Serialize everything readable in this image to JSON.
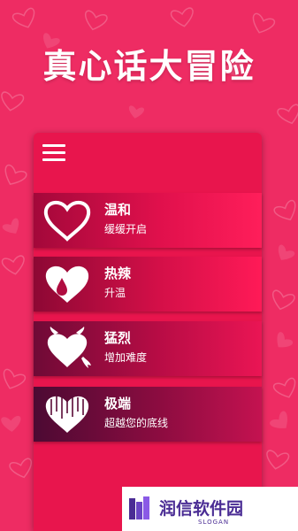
{
  "app": {
    "title": "真心话大冒险"
  },
  "menu": {
    "icon": "hamburger-menu-icon"
  },
  "modes": [
    {
      "label": "温和",
      "desc": "缓缓开启",
      "icon": "heart-outline-icon"
    },
    {
      "label": "热辣",
      "desc": "升温",
      "icon": "heart-drop-icon"
    },
    {
      "label": "猛烈",
      "desc": "增加难度",
      "icon": "devil-heart-icon"
    },
    {
      "label": "极端",
      "desc": "超越您的底线",
      "icon": "broken-heart-icon"
    }
  ],
  "watermark": {
    "text": "润信软件园",
    "slogan": "SLOGAN"
  },
  "colors": {
    "background": "#ee2c63",
    "card": "#e8154d",
    "watermark_text": "#4a2c94"
  }
}
